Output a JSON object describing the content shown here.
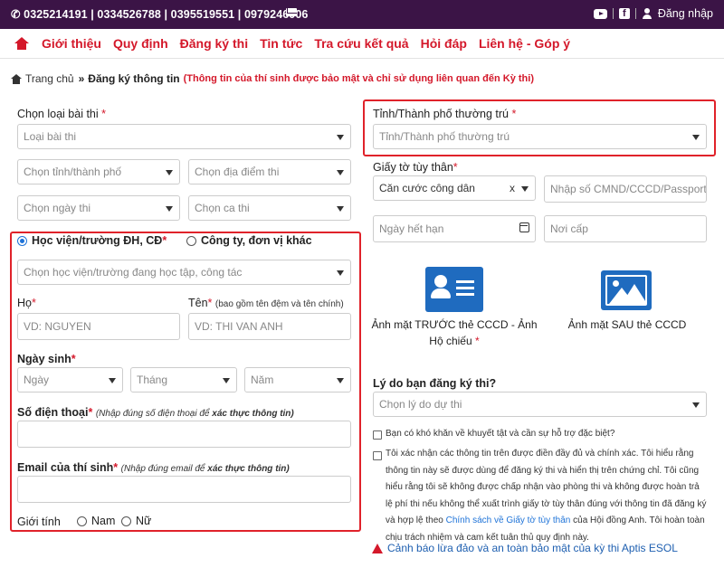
{
  "topbar": {
    "phones": "0325214191 | 0334526788 | 0395519551 | 0979246006",
    "login_label": "Đăng nhập"
  },
  "nav": {
    "items": [
      "Giới thiệu",
      "Quy định",
      "Đăng ký thi",
      "Tin tức",
      "Tra cứu kết quả",
      "Hỏi đáp",
      "Liên hệ - Góp ý"
    ]
  },
  "breadcrumb": {
    "home": "Trang chủ",
    "separator": "»",
    "current": "Đăng ký thông tin",
    "note": "(Thông tin của thí sinh được bảo mật và chỉ sử dụng liên quan đến Kỳ thi)"
  },
  "left": {
    "exam_type_label": "Chọn loại bài thi",
    "exam_type_placeholder": "Loại bài thi",
    "province_placeholder": "Chọn tỉnh/thành phố",
    "venue_placeholder": "Chọn địa điểm thi",
    "date_placeholder": "Chọn ngày thi",
    "shift_placeholder": "Chọn ca thi",
    "radio_school": "Học viện/trường ĐH, CĐ",
    "radio_company": "Công ty, đơn vị khác",
    "school_placeholder": "Chọn học viện/trường đang học tập, công tác",
    "last_name_label": "Họ",
    "first_name_label": "Tên",
    "first_name_hint": "(bao gồm tên đệm và tên chính)",
    "last_name_placeholder": "VD: NGUYEN",
    "first_name_placeholder": "VD: THI VAN ANH",
    "dob_label": "Ngày sinh",
    "day_placeholder": "Ngày",
    "month_placeholder": "Tháng",
    "year_placeholder": "Năm",
    "phone_label": "Số điện thoại",
    "phone_hint": "(Nhập đúng số điện thoại để",
    "phone_hint_bold": "xác thực thông tin)",
    "email_label": "Email của thí sinh",
    "email_hint": "(Nhập đúng email để",
    "email_hint_bold": "xác thực thông tin)",
    "gender_label": "Giới tính",
    "gender_male": "Nam",
    "gender_female": "Nữ"
  },
  "right": {
    "residence_label": "Tỉnh/Thành phố thường trú",
    "residence_placeholder": "Tỉnh/Thành phố thường trú",
    "id_label": "Giấy tờ tùy thân",
    "id_type_value": "Căn cước công dân",
    "id_clear": "x",
    "id_number_placeholder": "Nhập số CMND/CCCD/Passport",
    "expiry_placeholder": "Ngày hết hạn",
    "issue_place_placeholder": "Nơi cấp",
    "front_caption_1": "Ảnh mặt TRƯỚC thẻ CCCD - Ảnh",
    "front_caption_2": "Hộ chiếu",
    "back_caption": "Ảnh mặt SAU thẻ CCCD",
    "reason_label": "Lý do bạn đăng ký thi?",
    "reason_placeholder": "Chọn lý do dự thi",
    "support_text": "Bạn có khó khăn về khuyết tật và cần sự hỗ trợ đặc biệt?",
    "confirm_text": "Tôi xác nhận các thông tin trên được điền đầy đủ và chính xác. Tôi hiểu rằng thông tin này sẽ được dùng để đăng ký thi và hiển thị trên chứng chỉ. Tôi cũng hiểu rằng tôi sẽ không được chấp nhận vào phòng thi và không được hoàn trả lệ phí thi nếu không thể xuất trình giấy tờ tùy thân đúng với thông tin đã đăng ký và hợp lệ theo",
    "confirm_link": "Chính sách về Giấy tờ tùy thân",
    "confirm_tail": "của Hội đồng Anh. Tôi hoàn toàn chịu trách nhiệm và cam kết tuân thủ quy định này.",
    "warning_text": "Cảnh báo lừa đảo và an toàn bảo mật của kỳ thi Aptis ESOL"
  },
  "colors": {
    "topbar_bg": "#3b1446",
    "nav_red": "#d4182a",
    "highlight_border": "#e0222a",
    "icon_blue": "#1f6bbf",
    "link_blue": "#1e73d8"
  }
}
